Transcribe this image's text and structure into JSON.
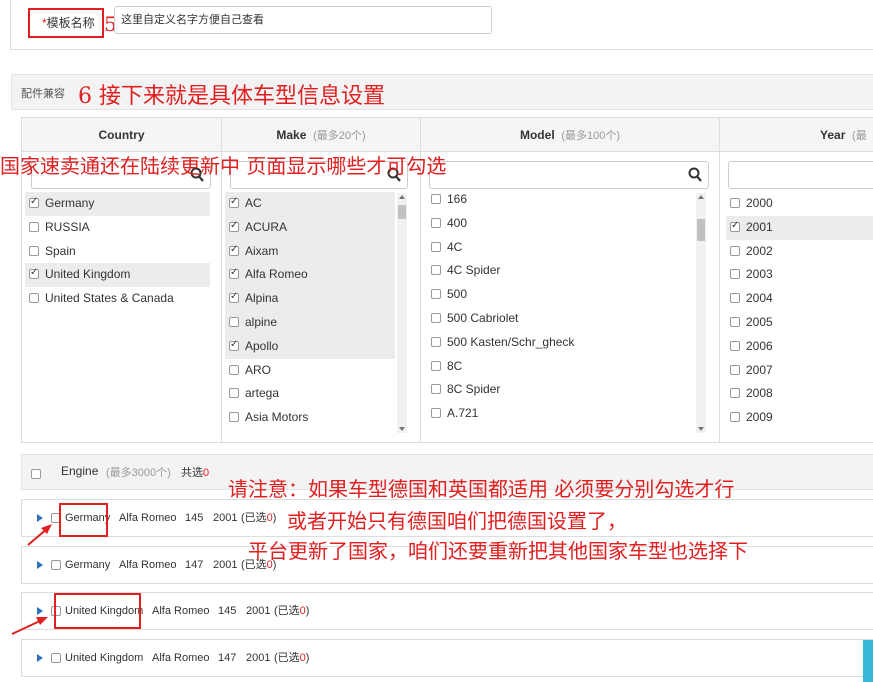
{
  "template": {
    "label_star": "*",
    "label": "模板名称",
    "step": "5",
    "input_value": "这里自定义名字方便自己查看"
  },
  "compat": {
    "label": "配件兼容",
    "step_note": "6  接下来就是具体车型信息设置"
  },
  "columns": {
    "country": {
      "title": "Country",
      "note": ""
    },
    "make": {
      "title": "Make",
      "note": "(最多20个)"
    },
    "model": {
      "title": "Model",
      "note": "(最多100个)"
    },
    "year": {
      "title": "Year",
      "note": "(最"
    }
  },
  "countries": [
    {
      "label": "Germany",
      "checked": true
    },
    {
      "label": "RUSSIA",
      "checked": false
    },
    {
      "label": "Spain",
      "checked": false
    },
    {
      "label": "United Kingdom",
      "checked": true
    },
    {
      "label": "United States & Canada",
      "checked": false
    }
  ],
  "makes": [
    {
      "label": "AC",
      "checked": true
    },
    {
      "label": "ACURA",
      "checked": true
    },
    {
      "label": "Aixam",
      "checked": true
    },
    {
      "label": "Alfa Romeo",
      "checked": true
    },
    {
      "label": "Alpina",
      "checked": true
    },
    {
      "label": "alpine",
      "checked": false
    },
    {
      "label": "Apollo",
      "checked": true
    },
    {
      "label": "ARO",
      "checked": false
    },
    {
      "label": "artega",
      "checked": false
    },
    {
      "label": "Asia Motors",
      "checked": false
    }
  ],
  "models": [
    {
      "label": "166",
      "checked": false
    },
    {
      "label": "400",
      "checked": false
    },
    {
      "label": "4C",
      "checked": false
    },
    {
      "label": "4C Spider",
      "checked": false
    },
    {
      "label": "500",
      "checked": false
    },
    {
      "label": "500 Cabriolet",
      "checked": false
    },
    {
      "label": "500 Kasten/Schr_gheck",
      "checked": false
    },
    {
      "label": "8C",
      "checked": false
    },
    {
      "label": "8C Spider",
      "checked": false
    },
    {
      "label": "A.721",
      "checked": false
    }
  ],
  "years": [
    {
      "label": "2000",
      "checked": false
    },
    {
      "label": "2001",
      "checked": true
    },
    {
      "label": "2002",
      "checked": false
    },
    {
      "label": "2003",
      "checked": false
    },
    {
      "label": "2004",
      "checked": false
    },
    {
      "label": "2005",
      "checked": false
    },
    {
      "label": "2006",
      "checked": false
    },
    {
      "label": "2007",
      "checked": false
    },
    {
      "label": "2008",
      "checked": false
    },
    {
      "label": "2009",
      "checked": false
    }
  ],
  "overlay_country": "国家速卖通还在陆续更新中  页面显示哪些才可勾选",
  "engine": {
    "label": "Engine",
    "note": "(最多3000个)",
    "selected_prefix": "共选",
    "selected_count": "0"
  },
  "results": [
    {
      "country": "Germany",
      "make": "Alfa Romeo",
      "model": "145",
      "year": "2001",
      "sel_prefix": "(已选",
      "sel_count": "0",
      "sel_suffix": ")"
    },
    {
      "country": "Germany",
      "make": "Alfa Romeo",
      "model": "147",
      "year": "2001",
      "sel_prefix": "(已选",
      "sel_count": "0",
      "sel_suffix": ")"
    },
    {
      "country": "United Kingdom",
      "make": "Alfa Romeo",
      "model": "145",
      "year": "2001",
      "sel_prefix": "(已选",
      "sel_count": "0",
      "sel_suffix": ")"
    },
    {
      "country": "United Kingdom",
      "make": "Alfa Romeo",
      "model": "147",
      "year": "2001",
      "sel_prefix": "(已选",
      "sel_count": "0",
      "sel_suffix": ")"
    }
  ],
  "annotations": {
    "line1": "请注意：如果车型德国和英国都适用  必须要分别勾选才行",
    "line2": "或者开始只有德国咱们把德国设置了，",
    "line3": "平台更新了国家，咱们还要重新把其他国家车型也选择下"
  },
  "colors": {
    "annotation": "#e02020",
    "accent": "#2f6fbf",
    "side_tab": "#37b8d8"
  }
}
